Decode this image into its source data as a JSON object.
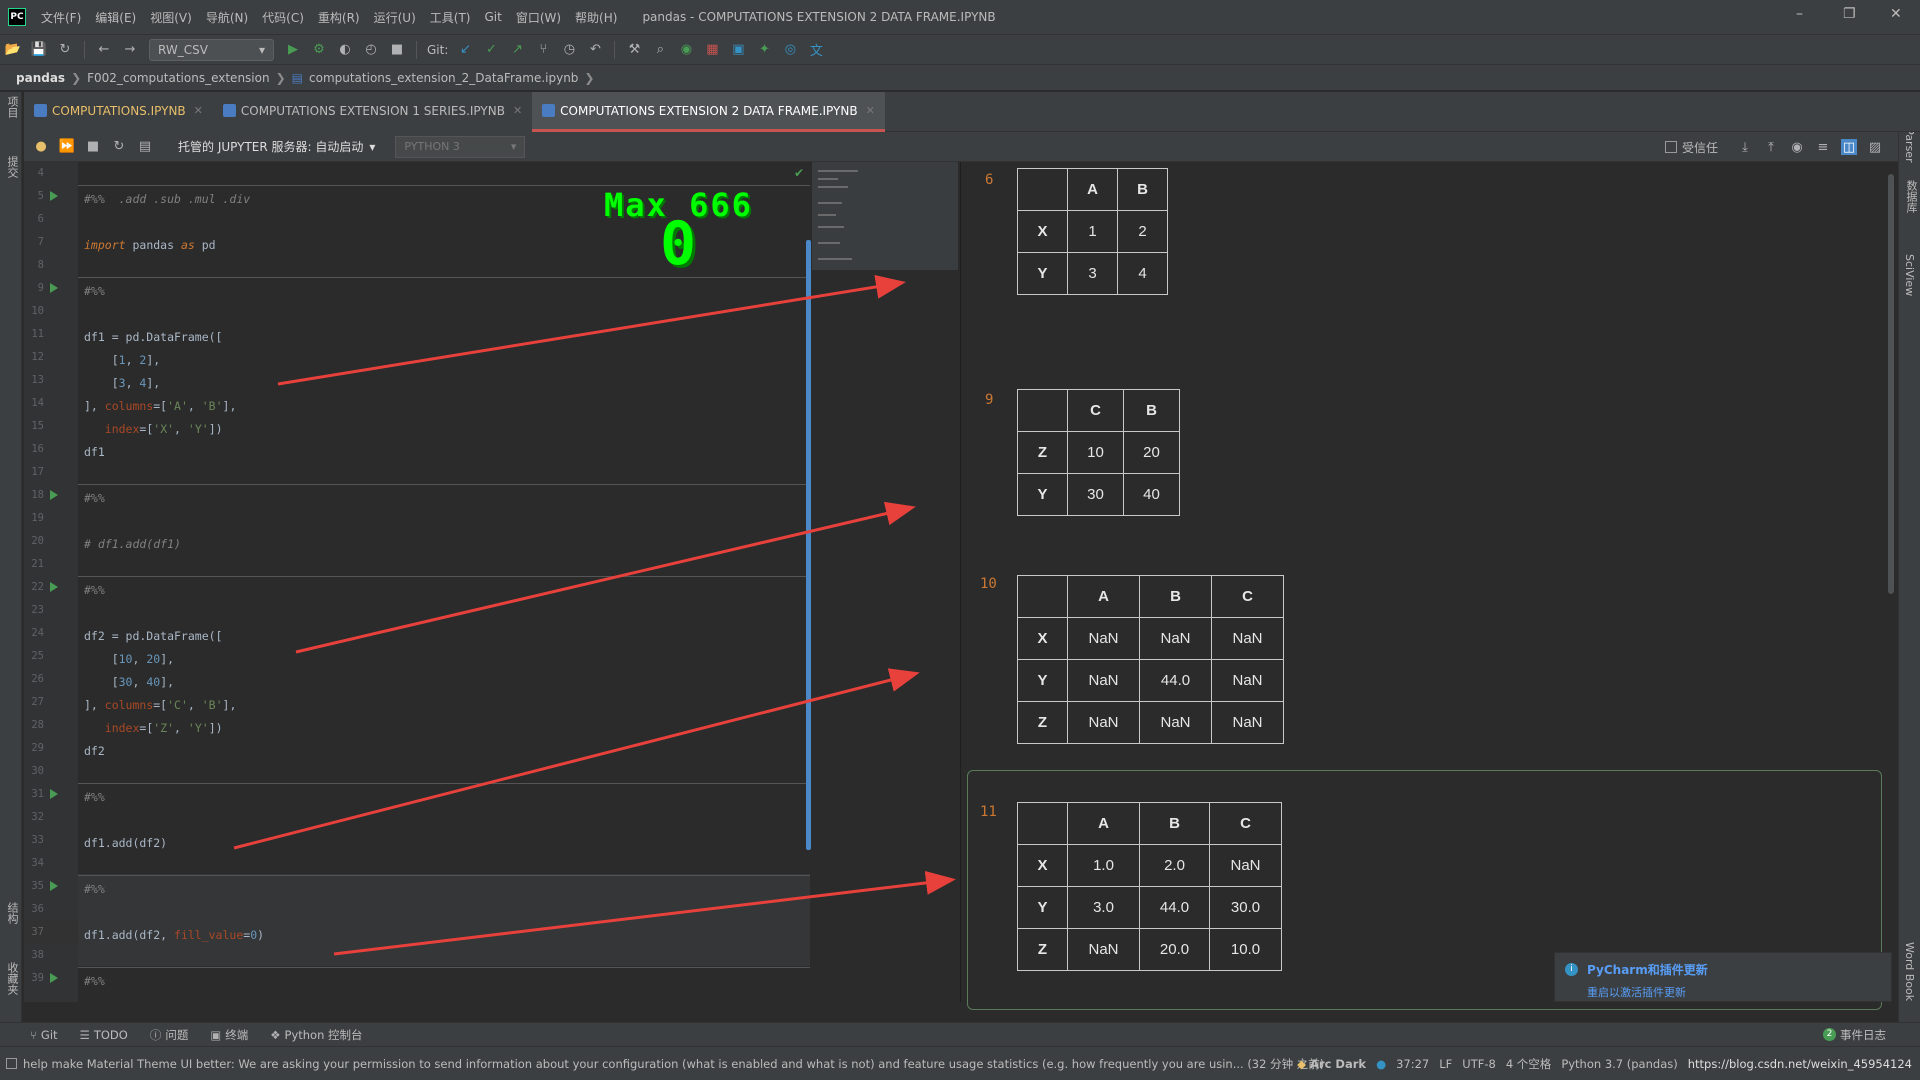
{
  "menubar": {
    "logo": "PC",
    "items": [
      "文件(F)",
      "编辑(E)",
      "视图(V)",
      "导航(N)",
      "代码(C)",
      "重构(R)",
      "运行(U)",
      "工具(T)",
      "Git",
      "窗口(W)",
      "帮助(H)"
    ],
    "window_title": "pandas - COMPUTATIONS EXTENSION 2 DATA FRAME.IPYNB"
  },
  "toolbar": {
    "run_config": "RW_CSV",
    "git_label": "Git:"
  },
  "breadcrumb": [
    "pandas",
    "F002_computations_extension",
    "computations_extension_2_DataFrame.ipynb"
  ],
  "tabs": [
    {
      "label": "COMPUTATIONS.IPYNB"
    },
    {
      "label": "COMPUTATIONS EXTENSION 1 SERIES.IPYNB"
    },
    {
      "label": "COMPUTATIONS EXTENSION 2 DATA FRAME.IPYNB"
    }
  ],
  "left_strip": {
    "project": "项目",
    "commit": "提交",
    "structure": "结构",
    "favorites": "收藏夹"
  },
  "right_strip": {
    "json_parser": "Json Parser",
    "database": "数据库",
    "sciview": "SciView",
    "wordbook": "Word Book"
  },
  "nb_toolbar": {
    "server": "托管的 JUPYTER 服务器: 自动启动",
    "kernel": "PYTHON 3",
    "trusted": "受信任"
  },
  "editor": {
    "lines": [
      {
        "n": "4",
        "tokens": []
      },
      {
        "n": "5",
        "tokens": [
          {
            "t": "#%%  .add .sub .mul .div",
            "c": "c-comment"
          }
        ]
      },
      {
        "n": "6",
        "tokens": []
      },
      {
        "n": "7",
        "tokens": [
          {
            "t": "import",
            "c": "c-kw"
          },
          {
            "t": " pandas ",
            "c": "c-id"
          },
          {
            "t": "as",
            "c": "c-kw"
          },
          {
            "t": " pd",
            "c": "c-id"
          }
        ]
      },
      {
        "n": "8",
        "tokens": []
      },
      {
        "n": "9",
        "tokens": [
          {
            "t": "#%%",
            "c": "c-comment"
          }
        ]
      },
      {
        "n": "10",
        "tokens": []
      },
      {
        "n": "11",
        "tokens": [
          {
            "t": "df1 = pd.DataFrame([",
            "c": "c-id"
          }
        ]
      },
      {
        "n": "12",
        "tokens": [
          {
            "t": "    [",
            "c": "c-id"
          },
          {
            "t": "1",
            "c": "c-num"
          },
          {
            "t": ", ",
            "c": "c-id"
          },
          {
            "t": "2",
            "c": "c-num"
          },
          {
            "t": "],",
            "c": "c-id"
          }
        ]
      },
      {
        "n": "13",
        "tokens": [
          {
            "t": "    [",
            "c": "c-id"
          },
          {
            "t": "3",
            "c": "c-num"
          },
          {
            "t": ", ",
            "c": "c-id"
          },
          {
            "t": "4",
            "c": "c-num"
          },
          {
            "t": "],",
            "c": "c-id"
          }
        ]
      },
      {
        "n": "14",
        "tokens": [
          {
            "t": "], ",
            "c": "c-id"
          },
          {
            "t": "columns",
            "c": "c-kwarg"
          },
          {
            "t": "=[",
            "c": "c-id"
          },
          {
            "t": "'A'",
            "c": "c-str"
          },
          {
            "t": ", ",
            "c": "c-id"
          },
          {
            "t": "'B'",
            "c": "c-str"
          },
          {
            "t": "],",
            "c": "c-id"
          }
        ]
      },
      {
        "n": "15",
        "tokens": [
          {
            "t": "   ",
            "c": "c-id"
          },
          {
            "t": "index",
            "c": "c-kwarg"
          },
          {
            "t": "=[",
            "c": "c-id"
          },
          {
            "t": "'X'",
            "c": "c-str"
          },
          {
            "t": ", ",
            "c": "c-id"
          },
          {
            "t": "'Y'",
            "c": "c-str"
          },
          {
            "t": "])",
            "c": "c-id"
          }
        ]
      },
      {
        "n": "16",
        "tokens": [
          {
            "t": "df1",
            "c": "c-id"
          }
        ]
      },
      {
        "n": "17",
        "tokens": []
      },
      {
        "n": "18",
        "tokens": [
          {
            "t": "#%%",
            "c": "c-comment"
          }
        ]
      },
      {
        "n": "19",
        "tokens": []
      },
      {
        "n": "20",
        "tokens": [
          {
            "t": "# df1.add(df1)",
            "c": "c-comment"
          }
        ]
      },
      {
        "n": "21",
        "tokens": []
      },
      {
        "n": "22",
        "tokens": [
          {
            "t": "#%%",
            "c": "c-comment"
          }
        ]
      },
      {
        "n": "23",
        "tokens": []
      },
      {
        "n": "24",
        "tokens": [
          {
            "t": "df2 = pd.DataFrame([",
            "c": "c-id"
          }
        ]
      },
      {
        "n": "25",
        "tokens": [
          {
            "t": "    [",
            "c": "c-id"
          },
          {
            "t": "10",
            "c": "c-num"
          },
          {
            "t": ", ",
            "c": "c-id"
          },
          {
            "t": "20",
            "c": "c-num"
          },
          {
            "t": "],",
            "c": "c-id"
          }
        ]
      },
      {
        "n": "26",
        "tokens": [
          {
            "t": "    [",
            "c": "c-id"
          },
          {
            "t": "30",
            "c": "c-num"
          },
          {
            "t": ", ",
            "c": "c-id"
          },
          {
            "t": "40",
            "c": "c-num"
          },
          {
            "t": "],",
            "c": "c-id"
          }
        ]
      },
      {
        "n": "27",
        "tokens": [
          {
            "t": "], ",
            "c": "c-id"
          },
          {
            "t": "columns",
            "c": "c-kwarg"
          },
          {
            "t": "=[",
            "c": "c-id"
          },
          {
            "t": "'C'",
            "c": "c-str"
          },
          {
            "t": ", ",
            "c": "c-id"
          },
          {
            "t": "'B'",
            "c": "c-str"
          },
          {
            "t": "],",
            "c": "c-id"
          }
        ]
      },
      {
        "n": "28",
        "tokens": [
          {
            "t": "   ",
            "c": "c-id"
          },
          {
            "t": "index",
            "c": "c-kwarg"
          },
          {
            "t": "=[",
            "c": "c-id"
          },
          {
            "t": "'Z'",
            "c": "c-str"
          },
          {
            "t": ", ",
            "c": "c-id"
          },
          {
            "t": "'Y'",
            "c": "c-str"
          },
          {
            "t": "])",
            "c": "c-id"
          }
        ]
      },
      {
        "n": "29",
        "tokens": [
          {
            "t": "df2",
            "c": "c-id"
          }
        ]
      },
      {
        "n": "30",
        "tokens": []
      },
      {
        "n": "31",
        "tokens": [
          {
            "t": "#%%",
            "c": "c-comment"
          }
        ]
      },
      {
        "n": "32",
        "tokens": []
      },
      {
        "n": "33",
        "tokens": [
          {
            "t": "df1.add(df2)",
            "c": "c-id"
          }
        ]
      },
      {
        "n": "34",
        "tokens": []
      },
      {
        "n": "35",
        "tokens": [
          {
            "t": "#%%",
            "c": "c-comment"
          }
        ]
      },
      {
        "n": "36",
        "tokens": []
      },
      {
        "n": "37",
        "tokens": [
          {
            "t": "df1.add(df2, ",
            "c": "c-id"
          },
          {
            "t": "fill_value",
            "c": "c-kwarg"
          },
          {
            "t": "=",
            "c": "c-id"
          },
          {
            "t": "0",
            "c": "c-num"
          },
          {
            "t": ")",
            "c": "c-id"
          }
        ]
      },
      {
        "n": "38",
        "tokens": []
      },
      {
        "n": "39",
        "tokens": [
          {
            "t": "#%%",
            "c": "c-comment"
          }
        ]
      }
    ]
  },
  "game": {
    "score_label": "Max 666",
    "count": "0"
  },
  "outputs": [
    {
      "num": "6",
      "columns": [
        "A",
        "B"
      ],
      "rows": [
        {
          "idx": "X",
          "vals": [
            "1",
            "2"
          ]
        },
        {
          "idx": "Y",
          "vals": [
            "3",
            "4"
          ]
        }
      ]
    },
    {
      "num": "9",
      "columns": [
        "C",
        "B"
      ],
      "rows": [
        {
          "idx": "Z",
          "vals": [
            "10",
            "20"
          ]
        },
        {
          "idx": "Y",
          "vals": [
            "30",
            "40"
          ]
        }
      ]
    },
    {
      "num": "10",
      "columns": [
        "A",
        "B",
        "C"
      ],
      "rows": [
        {
          "idx": "X",
          "vals": [
            "NaN",
            "NaN",
            "NaN"
          ]
        },
        {
          "idx": "Y",
          "vals": [
            "NaN",
            "44.0",
            "NaN"
          ]
        },
        {
          "idx": "Z",
          "vals": [
            "NaN",
            "NaN",
            "NaN"
          ]
        }
      ]
    },
    {
      "num": "11",
      "columns": [
        "A",
        "B",
        "C"
      ],
      "rows": [
        {
          "idx": "X",
          "vals": [
            "1.0",
            "2.0",
            "NaN"
          ]
        },
        {
          "idx": "Y",
          "vals": [
            "3.0",
            "44.0",
            "30.0"
          ]
        },
        {
          "idx": "Z",
          "vals": [
            "NaN",
            "20.0",
            "10.0"
          ]
        }
      ]
    }
  ],
  "notification": {
    "title": "PyCharm和插件更新",
    "link": "重启以激活插件更新"
  },
  "bottombar": {
    "items": [
      "Git",
      "TODO",
      "问题",
      "终端",
      "Python 控制台"
    ],
    "event_log": "事件日志",
    "event_count": "2"
  },
  "statusbar": {
    "message": "help make Material Theme UI better: We are asking your permission to send information about your configuration (what is enabled and what is not) and feature usage statistics (e.g. how frequently you are usin... (32 分钟 之前)",
    "theme": "Arc Dark",
    "position": "37:27",
    "line_sep": "LF",
    "encoding": "UTF-8",
    "indent": "4 个空格",
    "interpreter": "Python 3.7 (pandas) ",
    "watermark": "https://blog.csdn.net/weixin_45954124"
  },
  "colors": {
    "arrow": "#e8413c",
    "game_green": "#00ff00",
    "active_tab_underline": "#c75450"
  }
}
